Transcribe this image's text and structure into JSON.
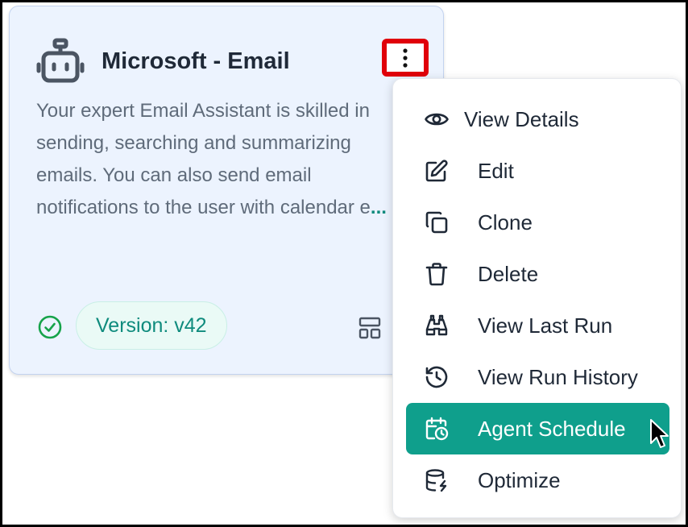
{
  "card": {
    "title": "Microsoft - Email",
    "description": "Your expert Email Assistant is skilled in sending, searching and summarizing emails. You can also send email notifications to the user with calendar e",
    "more": "...",
    "version": "Version: v42",
    "status": "check-circle-icon"
  },
  "menu": {
    "items": [
      {
        "label": "View Details",
        "icon": "eye-icon"
      },
      {
        "label": "Edit",
        "icon": "edit-icon"
      },
      {
        "label": "Clone",
        "icon": "copy-icon"
      },
      {
        "label": "Delete",
        "icon": "trash-icon"
      },
      {
        "label": "View Last Run",
        "icon": "binoculars-icon"
      },
      {
        "label": "View Run History",
        "icon": "history-icon"
      },
      {
        "label": "Agent Schedule",
        "icon": "calendar-clock-icon",
        "active": true
      },
      {
        "label": "Optimize",
        "icon": "database-zap-icon"
      }
    ]
  },
  "colors": {
    "accent": "#0f9f8c",
    "highlight_border": "#e0000a",
    "card_bg": "#ecf3fe",
    "title": "#1f2937"
  }
}
